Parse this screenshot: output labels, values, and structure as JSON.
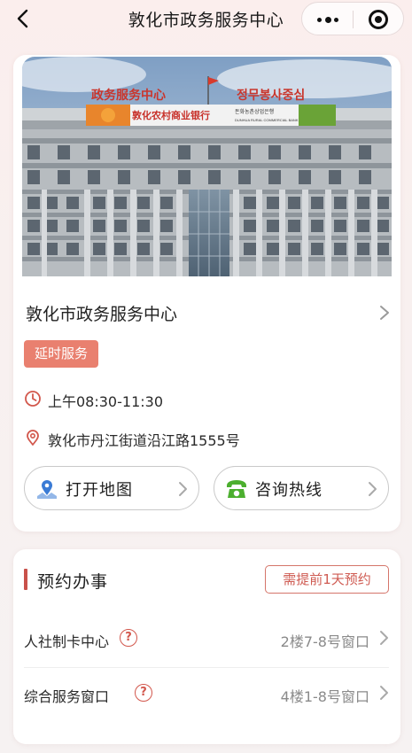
{
  "nav": {
    "title": "敦化市政务服务中心",
    "back_icon": "chevron-left-icon",
    "more_icon": "more-dots-icon",
    "close_icon": "target-circle-icon"
  },
  "center": {
    "photo_signage": {
      "left_sign": "政务服务中心",
      "right_sign": "정무봉사중심",
      "bank_name": "敦化农村商业银行",
      "bank_name_kr": "돈화농촌상업은행",
      "bank_name_en": "DUNHUA RURAL COMMERCIAL BANK"
    },
    "name": "敦化市政务服务中心",
    "badge": "延时服务",
    "hours": "上午08:30-11:30",
    "address": "敦化市丹江街道沿江路1555号",
    "open_map_label": "打开地图",
    "hotline_label": "咨询热线"
  },
  "appointments": {
    "title": "预约办事",
    "note": "需提前1天预约",
    "items": [
      {
        "name": "人社制卡中心",
        "location": "2楼7-8号窗口"
      },
      {
        "name": "综合服务窗口",
        "location": "4楼1-8号窗口"
      }
    ]
  },
  "colors": {
    "accent": "#c9514a",
    "badge_bg": "#e9806f",
    "map_icon": "#3a7bd5",
    "phone_icon": "#4caf2f"
  }
}
